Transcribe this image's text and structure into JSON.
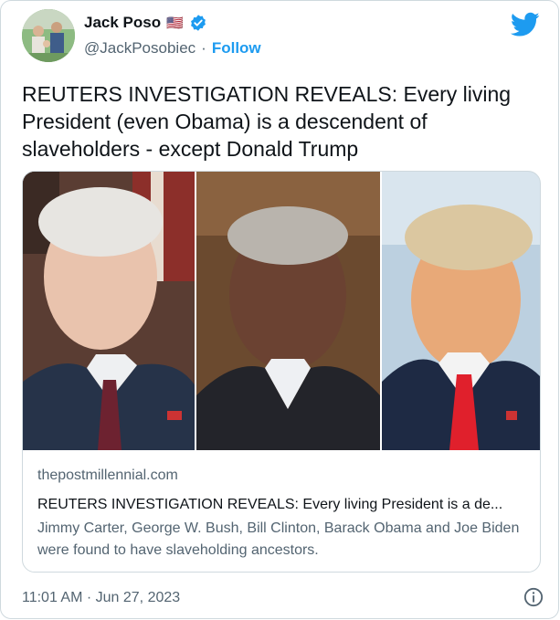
{
  "author": {
    "name": "Jack Poso",
    "flag": "🇺🇸",
    "handle": "@JackPosobiec",
    "separator": "·",
    "follow_label": "Follow"
  },
  "icons": {
    "brand": "twitter-bird-icon",
    "verified": "verified-badge-icon",
    "info": "info-icon",
    "brand_color": "#1d9bf0"
  },
  "tweet": {
    "text": "REUTERS INVESTIGATION REVEALS: Every living President (even Obama) is a descendent of slaveholders - except Donald Trump"
  },
  "link_card": {
    "domain": "thepostmillennial.com",
    "title": "REUTERS INVESTIGATION REVEALS: Every living President is a de...",
    "description": "Jimmy Carter, George W. Bush, Bill Clinton, Barack Obama and Joe Biden were found to have slaveholding ancestors."
  },
  "timestamp": "11:01 AM · Jun 27, 2023"
}
